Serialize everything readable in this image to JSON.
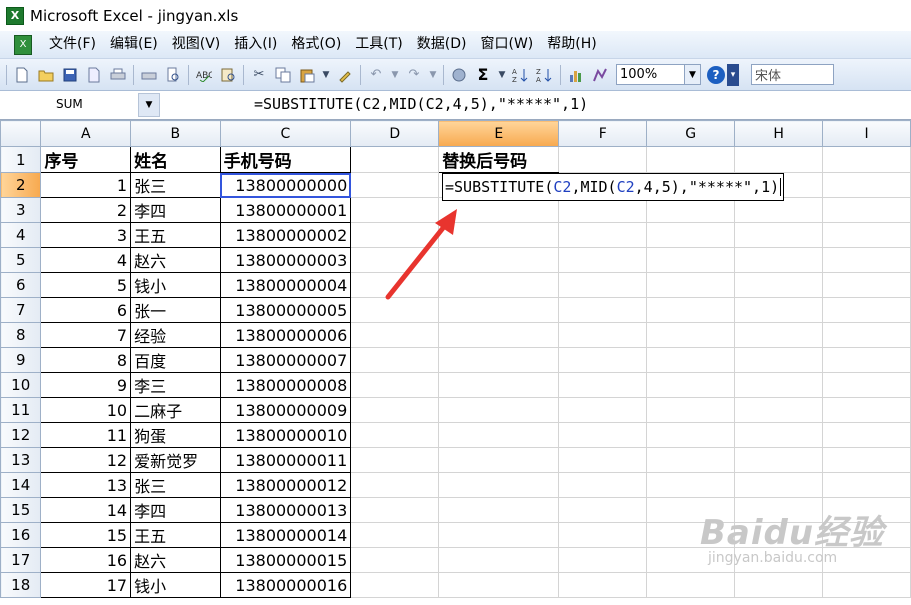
{
  "window": {
    "title": "Microsoft Excel - jingyan.xls",
    "app_icon": "excel-icon"
  },
  "menu": [
    "文件(F)",
    "编辑(E)",
    "视图(V)",
    "插入(I)",
    "格式(O)",
    "工具(T)",
    "数据(D)",
    "窗口(W)",
    "帮助(H)"
  ],
  "toolbar": {
    "zoom": "100%",
    "font": "宋体",
    "sum_symbol": "Σ",
    "help": "?"
  },
  "formula_bar": {
    "name_box": "SUM",
    "formula": "=SUBSTITUTE(C2,MID(C2,4,5),\"*****\",1)"
  },
  "columns": [
    "A",
    "B",
    "C",
    "D",
    "E",
    "F",
    "G",
    "H",
    "I"
  ],
  "active_column": "E",
  "rows": [
    {
      "n": "1",
      "a": "序号",
      "b": "姓名",
      "c": "手机号码",
      "e": "替换后号码"
    },
    {
      "n": "2",
      "a": "1",
      "b": "张三",
      "c": "13800000000"
    },
    {
      "n": "3",
      "a": "2",
      "b": "李四",
      "c": "13800000001"
    },
    {
      "n": "4",
      "a": "3",
      "b": "王五",
      "c": "13800000002"
    },
    {
      "n": "5",
      "a": "4",
      "b": "赵六",
      "c": "13800000003"
    },
    {
      "n": "6",
      "a": "5",
      "b": "钱小",
      "c": "13800000004"
    },
    {
      "n": "7",
      "a": "6",
      "b": "张一",
      "c": "13800000005"
    },
    {
      "n": "8",
      "a": "7",
      "b": "经验",
      "c": "13800000006"
    },
    {
      "n": "9",
      "a": "8",
      "b": "百度",
      "c": "13800000007"
    },
    {
      "n": "10",
      "a": "9",
      "b": "李三",
      "c": "13800000008"
    },
    {
      "n": "11",
      "a": "10",
      "b": "二麻子",
      "c": "13800000009"
    },
    {
      "n": "12",
      "a": "11",
      "b": "狗蛋",
      "c": "13800000010"
    },
    {
      "n": "13",
      "a": "12",
      "b": "爱新觉罗",
      "c": "13800000011"
    },
    {
      "n": "14",
      "a": "13",
      "b": "张三",
      "c": "13800000012"
    },
    {
      "n": "15",
      "a": "14",
      "b": "李四",
      "c": "13800000013"
    },
    {
      "n": "16",
      "a": "15",
      "b": "王五",
      "c": "13800000014"
    },
    {
      "n": "17",
      "a": "16",
      "b": "赵六",
      "c": "13800000015"
    },
    {
      "n": "18",
      "a": "17",
      "b": "钱小",
      "c": "13800000016"
    }
  ],
  "edit": {
    "parts": [
      "=SUBSTITUTE(",
      "C2",
      ",MID(",
      "C2",
      ",4,5),\"*****\",1)"
    ]
  },
  "watermark": {
    "logo": "Baidu经验",
    "url": "jingyan.baidu.com"
  },
  "colors": {
    "active_header": "#f7a94f",
    "reference": "#2040c0",
    "arrow": "#e8342e"
  }
}
